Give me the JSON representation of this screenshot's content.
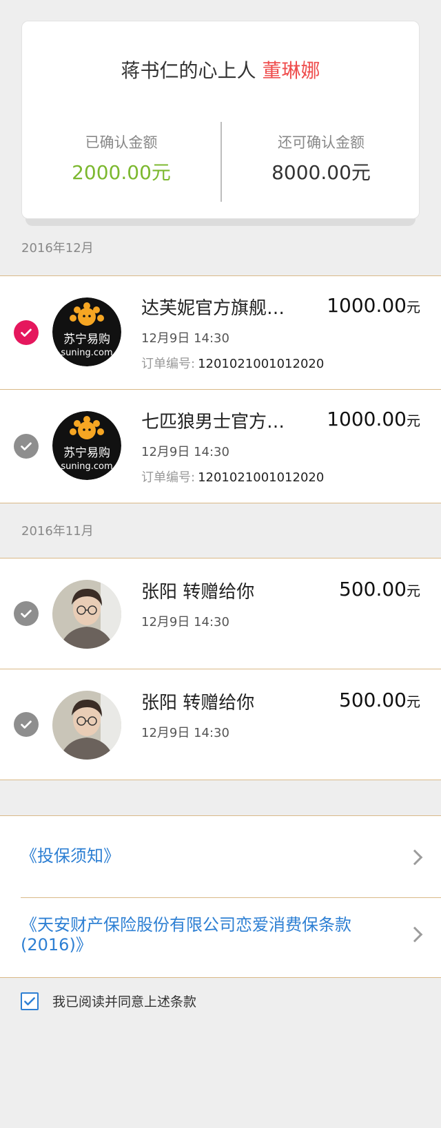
{
  "summary": {
    "title_prefix": "蒋书仁的心上人",
    "title_name": "董琳娜",
    "confirmed_label": "已确认金额",
    "confirmed_value": "2000.00元",
    "remaining_label": "还可确认金额",
    "remaining_value": "8000.00元",
    "colors": {
      "confirmed": "#7cb82f",
      "name": "#ef4e4e"
    }
  },
  "sections": [
    {
      "month": "2016年12月",
      "items": [
        {
          "checked": true,
          "avatar": "suning-logo",
          "logo_text": "苏宁易购",
          "logo_sub": "suning.com",
          "title": "达芙妮官方旗舰…",
          "amount": "1000.00",
          "unit": "元",
          "time": "12月9日 14:30",
          "order_label": "订单编号:",
          "order_no": "1201021001012020"
        },
        {
          "checked": false,
          "avatar": "suning-logo",
          "logo_text": "苏宁易购",
          "logo_sub": "suning.com",
          "title": "七匹狼男士官方…",
          "amount": "1000.00",
          "unit": "元",
          "time": "12月9日 14:30",
          "order_label": "订单编号:",
          "order_no": "1201021001012020"
        }
      ]
    },
    {
      "month": "2016年11月",
      "items": [
        {
          "checked": false,
          "avatar": "user-photo",
          "title": "张阳  转赠给你",
          "amount": "500.00",
          "unit": "元",
          "time": "12月9日 14:30"
        },
        {
          "checked": false,
          "avatar": "user-photo",
          "title": "张阳  转赠给你",
          "amount": "500.00",
          "unit": "元",
          "time": "12月9日 14:30"
        }
      ]
    }
  ],
  "terms": {
    "link1": "《投保须知》",
    "link2": "《天安财产保险股份有限公司恋爱消费保条款(2016)》",
    "agree_text": "我已阅读并同意上述条款",
    "agree_checked": true,
    "link_color": "#2d7fd3"
  },
  "accent_check_color": "#e5175d"
}
